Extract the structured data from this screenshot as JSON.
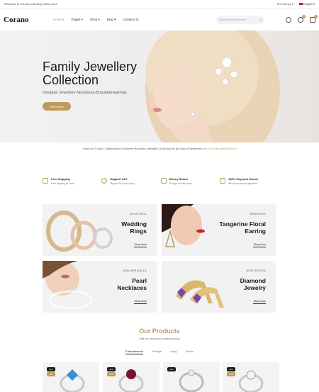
{
  "topbar": {
    "welcome": "Welcome to Corano Jewellery online store",
    "currency": "$ Currency ▾",
    "language": "English ▾"
  },
  "header": {
    "logo": "Corano",
    "nav": [
      {
        "label": "Home ▾"
      },
      {
        "label": "Pages ▾"
      },
      {
        "label": "Shop ▾"
      },
      {
        "label": "Blog ▾"
      },
      {
        "label": "Contact Us"
      }
    ],
    "search_placeholder": "Search entire store here",
    "wishlist_count": "0",
    "cart_count": "2"
  },
  "hero": {
    "title": "Family Jewellery Collection",
    "subtitle": "Designer Jewellery Necklaces-Bracelets-Earings",
    "button": "Read More"
  },
  "notice": {
    "text": "Check out \"Corano - Multipurpose eCommerce Bootstrap 4 template\" on #Envato by @Corano #Themeforest",
    "link": "http://1.envato.market/NLbd W"
  },
  "features": [
    {
      "title": "Free Shipping",
      "desc": "Free shipping all order"
    },
    {
      "title": "Support 24/7",
      "desc": "Support 24 hours a day"
    },
    {
      "title": "Money Return",
      "desc": "30 days for free return"
    },
    {
      "title": "100% Payment Secure",
      "desc": "We ensure secure payment"
    }
  ],
  "banners": [
    {
      "small": "BEAUTIFUL",
      "title1": "Wedding",
      "title2": "Rings",
      "shop": "Shop Now"
    },
    {
      "small": "EARRINGS",
      "title1": "Tangerine Floral",
      "title2": "Earring",
      "shop": "Shop Now"
    },
    {
      "small": "NEW ARRIVALLS",
      "title1": "Pearl",
      "title2": "Necklaces",
      "shop": "Shop Now"
    },
    {
      "small": "NEW DESIGN",
      "title1": "Diamond",
      "title2": "Jewelry",
      "shop": "Shop Now"
    }
  ],
  "products_section": {
    "title": "Our Products",
    "subtitle": "Add our products to weekly lineup",
    "tabs": [
      "Entertainment",
      "Storage",
      "Lying",
      "Tables"
    ]
  },
  "products": [
    {
      "label": "new",
      "discount": "10%"
    },
    {
      "label": "new",
      "discount": "10%"
    },
    {
      "label": "new",
      "discount": ""
    },
    {
      "label": "new",
      "discount": "10%"
    }
  ],
  "colors": {
    "accent": "#c09a5b",
    "text": "#1a1a1a",
    "panel": "#f2f2f2"
  }
}
